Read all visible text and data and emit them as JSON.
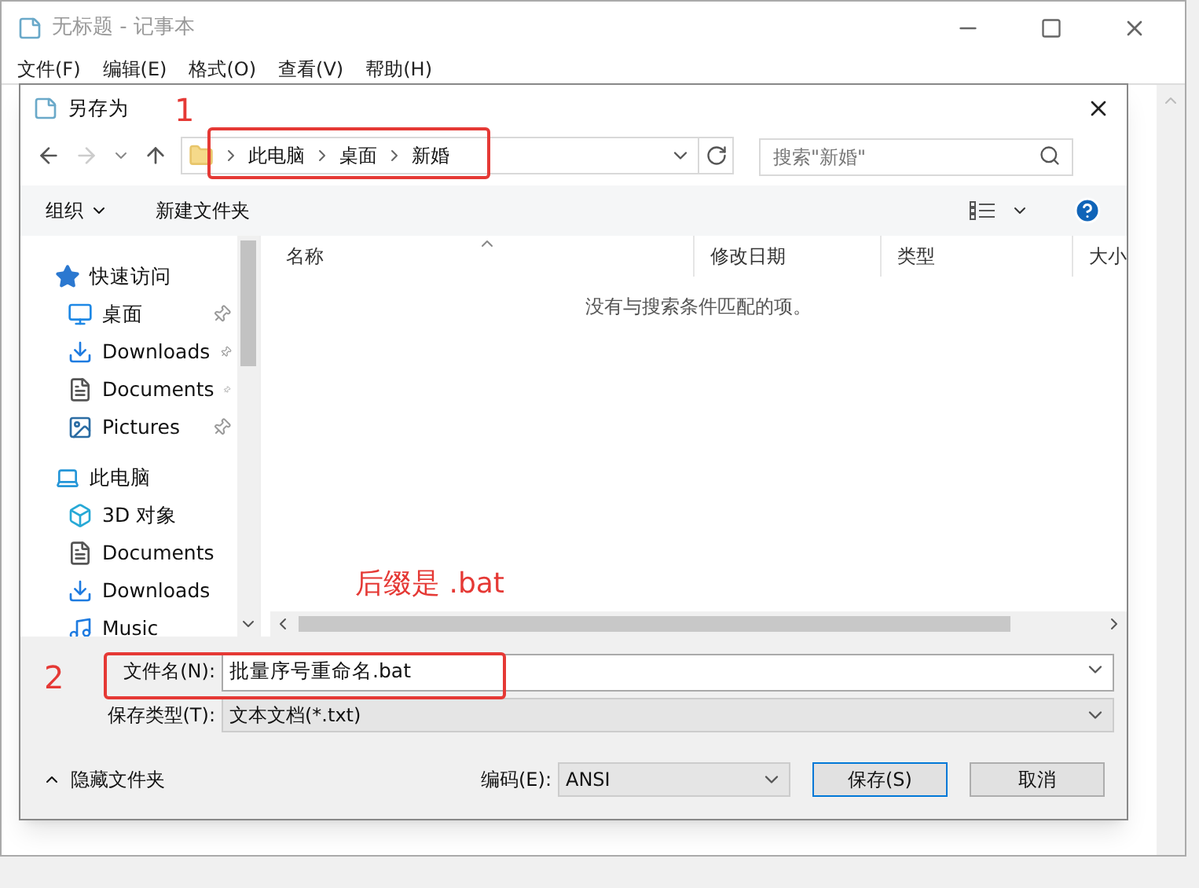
{
  "notepad": {
    "title": "无标题 - 记事本",
    "menu": [
      "文件(F)",
      "编辑(E)",
      "格式(O)",
      "查看(V)",
      "帮助(H)"
    ]
  },
  "dialog": {
    "title": "另存为",
    "breadcrumb": [
      "此电脑",
      "桌面",
      "新婚"
    ],
    "search": {
      "placeholder": "搜索\"新婚\""
    },
    "toolbar": {
      "organize": "组织",
      "new_folder": "新建文件夹"
    },
    "nav": [
      {
        "label": "快速访问",
        "kind": "star",
        "pinned": false,
        "children": [
          {
            "label": "桌面",
            "kind": "desktop",
            "pinned": true
          },
          {
            "label": "Downloads",
            "kind": "download",
            "pinned": true
          },
          {
            "label": "Documents",
            "kind": "document",
            "pinned": true
          },
          {
            "label": "Pictures",
            "kind": "picture",
            "pinned": true
          }
        ]
      },
      {
        "label": "此电脑",
        "kind": "computer",
        "pinned": false,
        "children": [
          {
            "label": "3D 对象",
            "kind": "cube",
            "pinned": false
          },
          {
            "label": "Documents",
            "kind": "document",
            "pinned": false
          },
          {
            "label": "Downloads",
            "kind": "download",
            "pinned": false
          },
          {
            "label": "Music",
            "kind": "music",
            "pinned": false
          }
        ]
      }
    ],
    "columns": [
      "名称",
      "修改日期",
      "类型",
      "大小"
    ],
    "empty_message": "没有与搜索条件匹配的项。",
    "file_name": {
      "label": "文件名(N):",
      "value": "批量序号重命名.bat"
    },
    "file_type": {
      "label": "保存类型(T):",
      "value": "文本文档(*.txt)"
    },
    "hide_folders": "隐藏文件夹",
    "encoding": {
      "label": "编码(E):",
      "value": "ANSI"
    },
    "buttons": [
      "保存(S)",
      "取消"
    ]
  },
  "annotations": [
    {
      "kind": "number",
      "text": "1"
    },
    {
      "kind": "note",
      "text": "后缀是 .bat"
    },
    {
      "kind": "number",
      "text": "2"
    }
  ]
}
